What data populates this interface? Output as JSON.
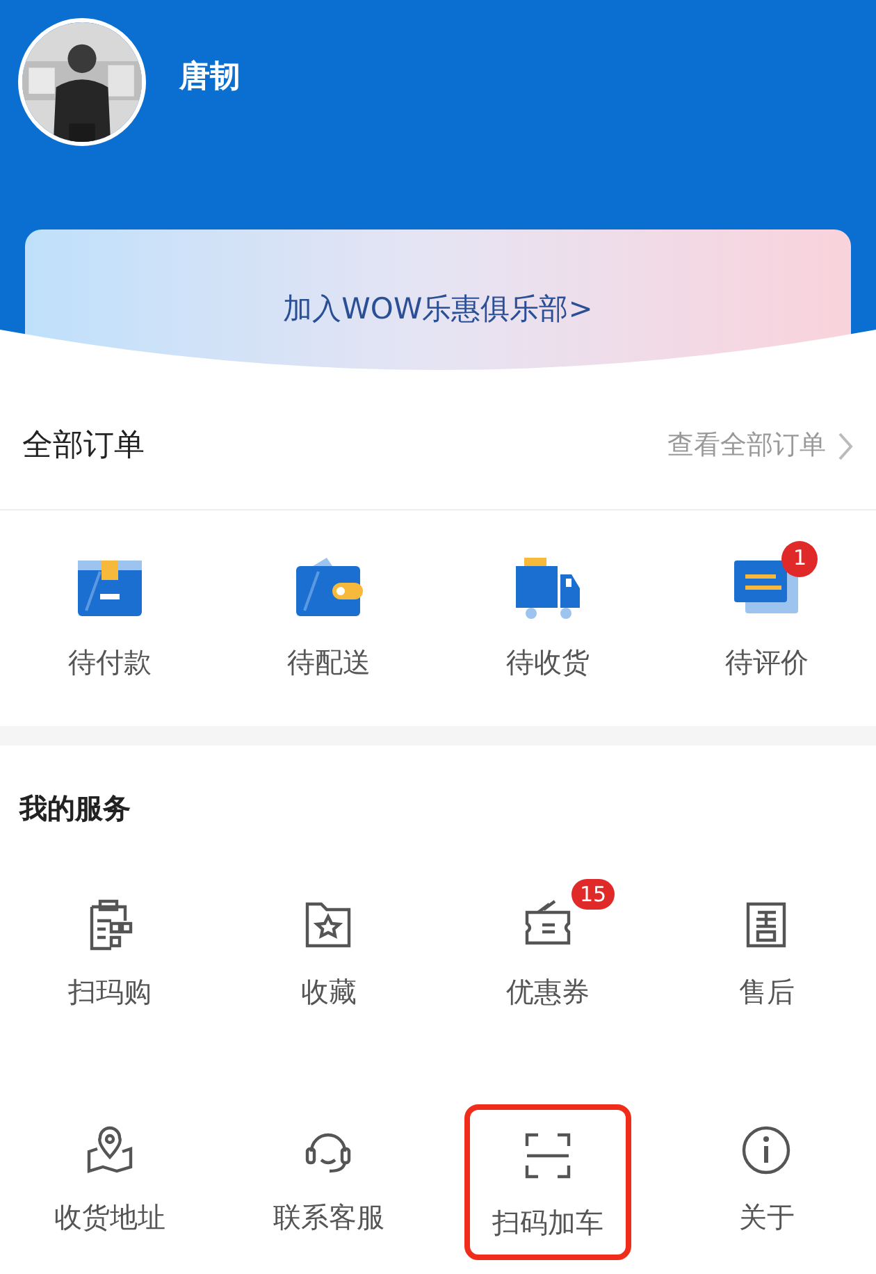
{
  "profile": {
    "name": "唐韧"
  },
  "club_banner": {
    "label": "加入WOW乐惠俱乐部>"
  },
  "orders": {
    "title": "全部订单",
    "link": "查看全部订单",
    "items": [
      {
        "label": "待付款"
      },
      {
        "label": "待配送"
      },
      {
        "label": "待收货"
      },
      {
        "label": "待评价",
        "badge": "1"
      }
    ]
  },
  "services": {
    "title": "我的服务",
    "items": [
      {
        "label": "扫玛购",
        "highlighted": false
      },
      {
        "label": "收藏",
        "highlighted": false
      },
      {
        "label": "优惠券",
        "badge": "15",
        "highlighted": false
      },
      {
        "label": "售后",
        "highlighted": false
      },
      {
        "label": "收货地址",
        "highlighted": false
      },
      {
        "label": "联系客服",
        "highlighted": false
      },
      {
        "label": "扫码加车",
        "highlighted": true
      },
      {
        "label": "关于",
        "highlighted": false
      }
    ]
  }
}
